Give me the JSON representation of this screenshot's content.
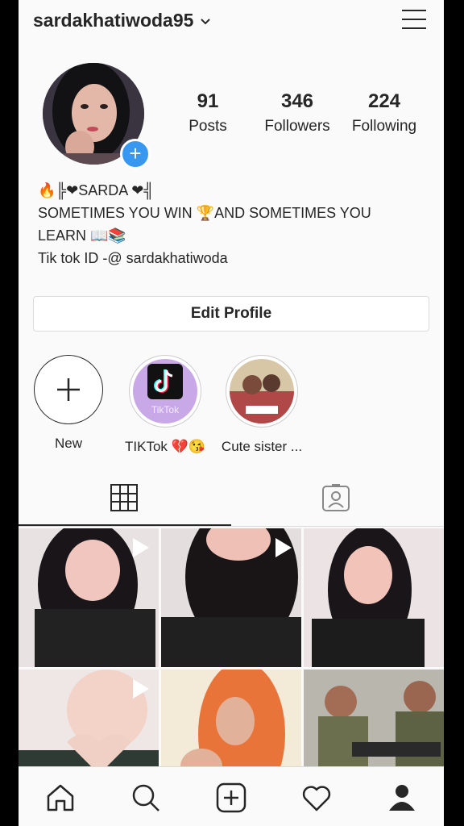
{
  "header": {
    "username": "sardakhatiwoda95",
    "chevron": "⌄"
  },
  "stats": [
    {
      "value": "91",
      "label": "Posts"
    },
    {
      "value": "346",
      "label": "Followers"
    },
    {
      "value": "224",
      "label": "Following"
    }
  ],
  "bio": {
    "line1": "🔥╠❤SARDA ❤╣",
    "line2": "SOMETIMES YOU WIN 🏆AND SOMETIMES YOU",
    "line3": "LEARN 📖📚",
    "line4": "Tik tok ID -@ sardakhatiwoda"
  },
  "edit_profile": "Edit Profile",
  "highlights": [
    {
      "label": "New"
    },
    {
      "label": "TIKTok 💔😘",
      "inner_text": "TikTok"
    },
    {
      "label": "Cute sister ..."
    }
  ],
  "tabs": {
    "active": "grid",
    "items": [
      "grid-icon",
      "tagged-icon"
    ]
  },
  "posts": [
    {
      "is_video": true
    },
    {
      "is_video": true
    },
    {
      "is_video": false
    },
    {
      "is_video": true
    },
    {
      "is_video": false
    },
    {
      "is_video": false
    }
  ],
  "bottom_nav": [
    "home-icon",
    "search-icon",
    "add-post-icon",
    "heart-icon",
    "profile-icon"
  ],
  "colors": {
    "accent": "#3897f0",
    "text": "#262626",
    "border": "#dbdbdb"
  }
}
